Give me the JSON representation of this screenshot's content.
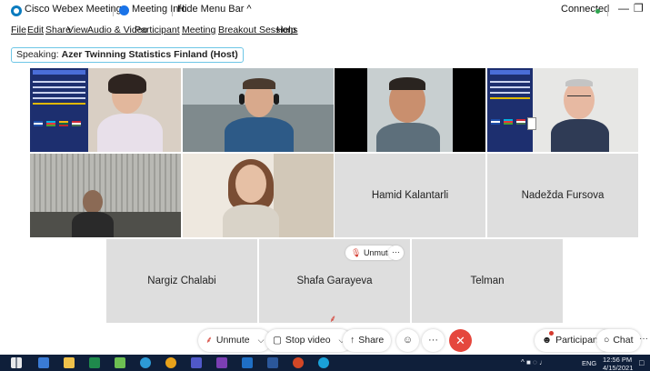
{
  "app": {
    "title": "Cisco Webex Meetings",
    "meeting_info": "Meeting Info",
    "hide_menu_bar": "Hide Menu Bar ^",
    "status": "Connected",
    "minimize": "—",
    "restore": "❐"
  },
  "menu": {
    "items": [
      "File",
      "Edit",
      "Share",
      "View",
      "Audio & Video",
      "Participant",
      "Meeting",
      "Breakout Sessions",
      "Help"
    ]
  },
  "speaking": {
    "prefix": "Speaking:",
    "name": "Azer Twinning Statistics Finland (Host)"
  },
  "participants": {
    "name_tiles": [
      "Hamid Kalantarli",
      "Nadežda Fursova",
      "Nargiz Chalabi",
      "Shafa Garayeva",
      "Telman"
    ]
  },
  "tile_controls": {
    "unmute": "Unmute",
    "more": "···"
  },
  "controls": {
    "unmute": "Unmute",
    "stop_video": "Stop video",
    "share": "Share",
    "participants": "Participants",
    "chat": "Chat",
    "more": "···"
  },
  "taskbar": {
    "time": "12:56 PM",
    "date": "4/15/2021",
    "lang": "ENG"
  },
  "colors": {
    "accent": "#0a7bbf",
    "leave_red": "#e5473d",
    "tile_grey": "#dedede",
    "taskbar": "#0f1f3a"
  }
}
